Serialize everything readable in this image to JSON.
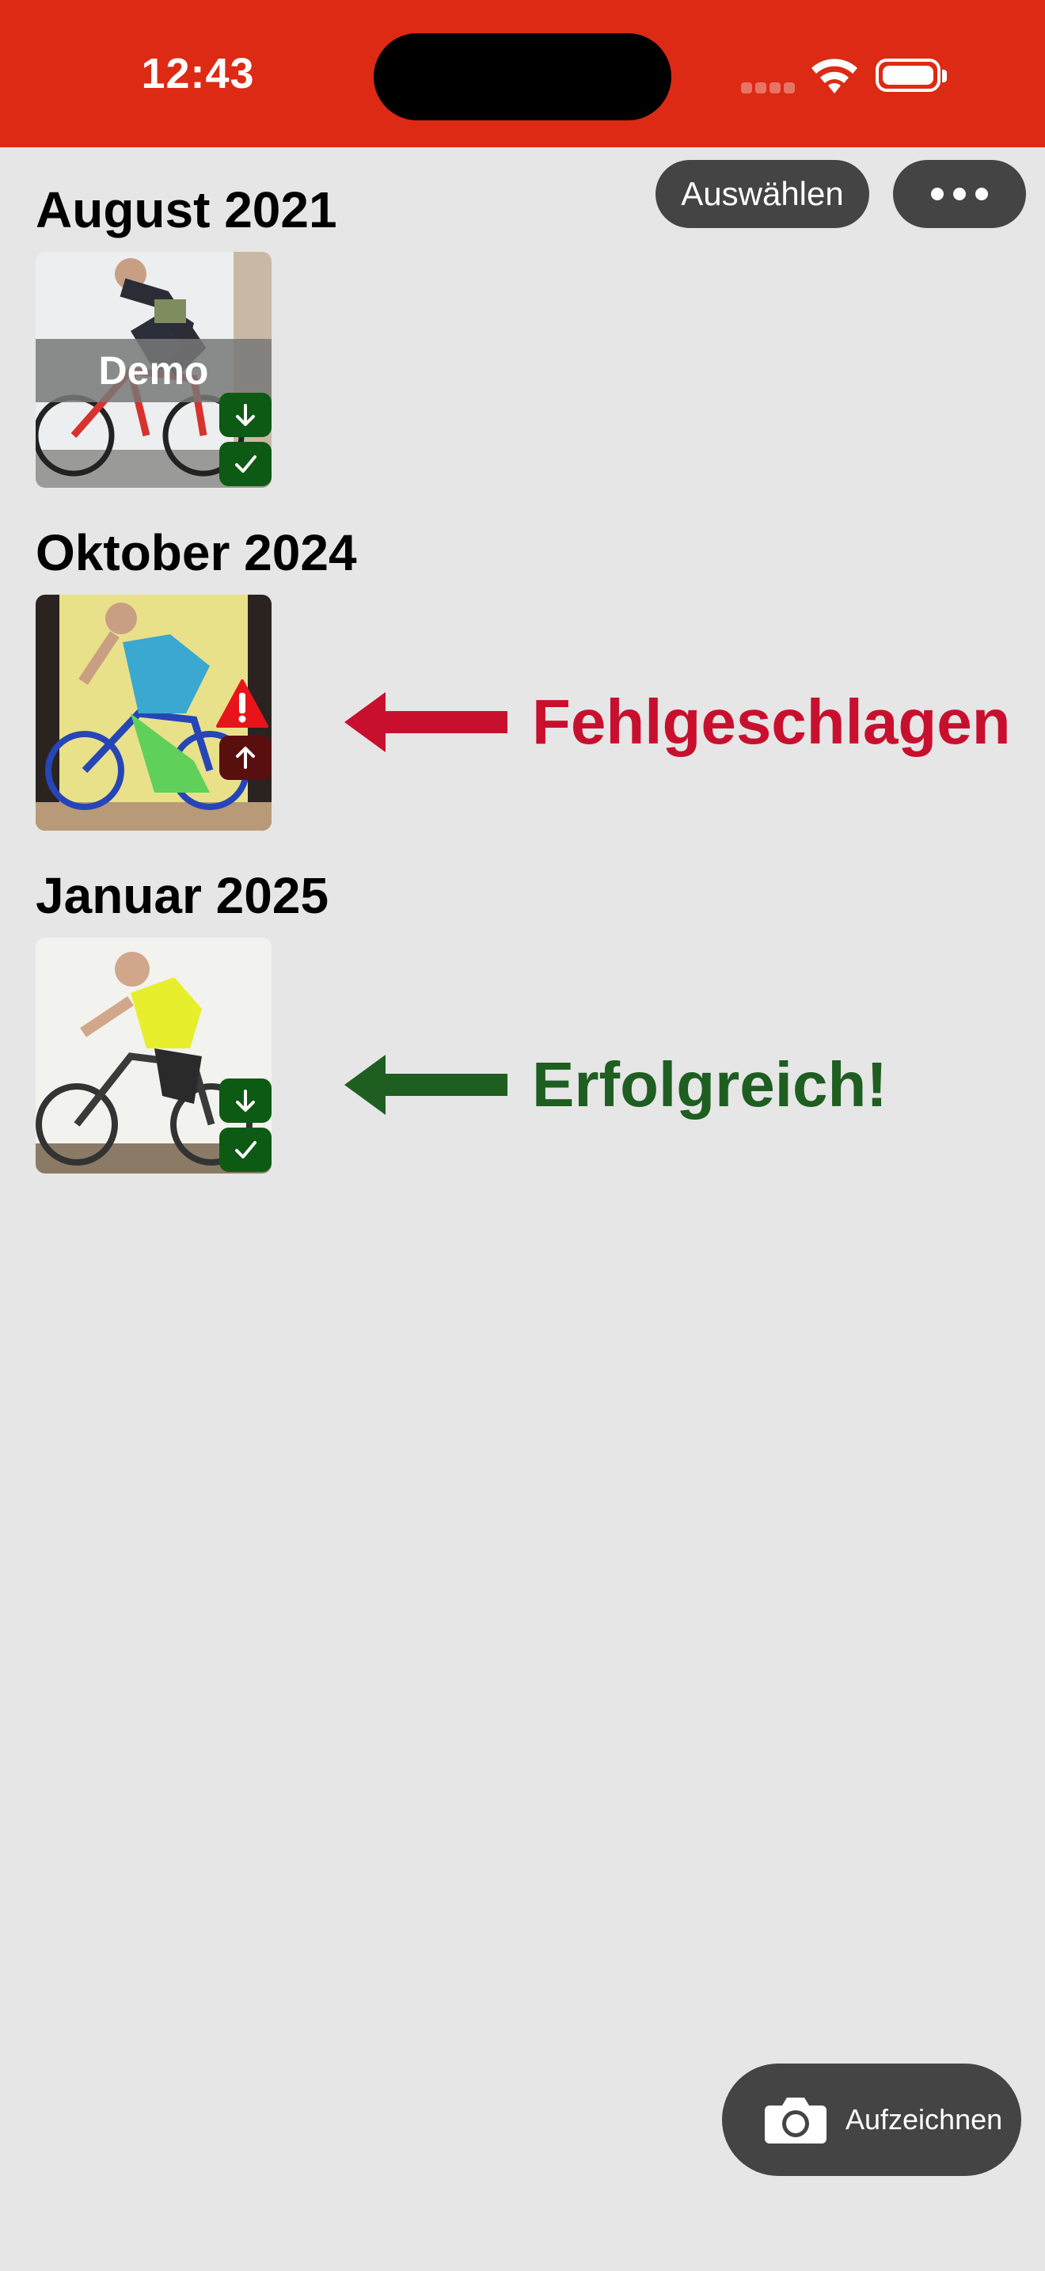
{
  "status_bar": {
    "time": "12:43",
    "background": "#dc2a14"
  },
  "toolbar": {
    "select_label": "Auswählen",
    "more_icon": "ellipsis-icon"
  },
  "sections": [
    {
      "title": "August 2021",
      "overlay_label": "Demo",
      "status": "downloaded-verified"
    },
    {
      "title": "Oktober 2024",
      "status": "upload-failed"
    },
    {
      "title": "Januar 2025",
      "status": "downloaded-verified"
    }
  ],
  "annotations": {
    "failed": {
      "text": "Fehlgeschlagen",
      "color": "#c8102e"
    },
    "success": {
      "text": "Erfolgreich!",
      "color": "#1e5e21"
    }
  },
  "record_button": {
    "label": "Aufzeichnen",
    "icon": "camera-icon"
  }
}
